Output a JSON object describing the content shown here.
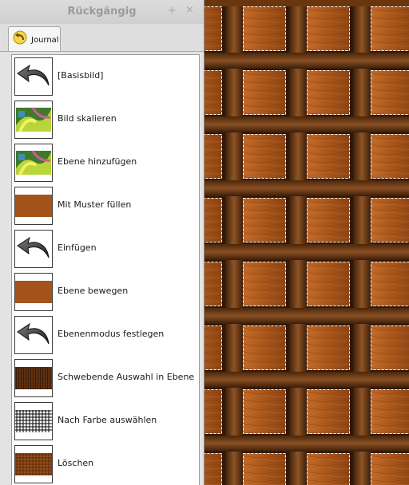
{
  "dock": {
    "title": "Rückgängig",
    "pin_glyph": "+",
    "close_glyph": "×",
    "tab_label": "Journal",
    "tab_icon": "undo-arrow-icon",
    "menu_icon": "tab-menu-arrow-icon"
  },
  "history": [
    {
      "label": "[Basisbild]",
      "thumb": "undo-arrow"
    },
    {
      "label": "Bild skalieren",
      "thumb": "image"
    },
    {
      "label": "Ebene hinzufügen",
      "thumb": "image"
    },
    {
      "label": "Mit Muster füllen",
      "thumb": "brown"
    },
    {
      "label": "Einfügen",
      "thumb": "undo-arrow"
    },
    {
      "label": "Ebene bewegen",
      "thumb": "brown"
    },
    {
      "label": "Ebenenmodus festlegen",
      "thumb": "undo-arrow"
    },
    {
      "label": "Schwebende Auswahl in Ebene",
      "thumb": "weave"
    },
    {
      "label": "Nach Farbe auswählen",
      "thumb": "grid"
    },
    {
      "label": "Löschen",
      "thumb": "texture"
    }
  ],
  "colors": {
    "wood_plank": "#a9591b",
    "wood_strap": "#6e3e18",
    "gap_dark": "#2e1808",
    "selection": "#ffffff"
  }
}
